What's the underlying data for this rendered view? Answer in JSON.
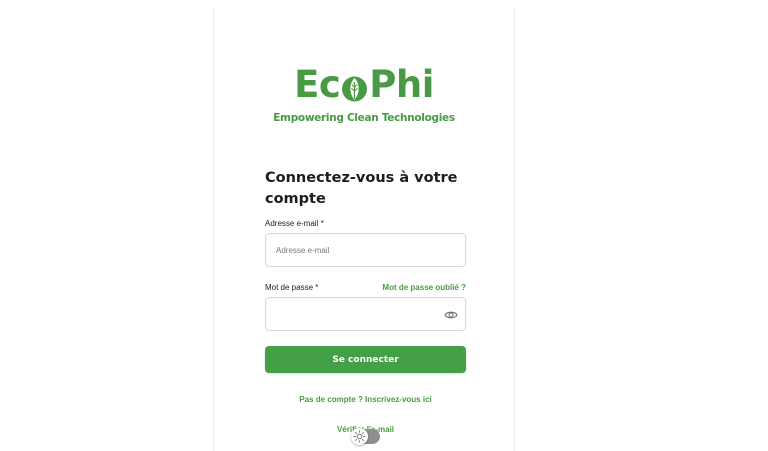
{
  "brand": {
    "name_left": "Ec",
    "name_right": "Phi",
    "tagline": "Empowering Clean Technologies"
  },
  "form": {
    "title": "Connectez-vous à votre compte",
    "email_label": "Adresse e-mail *",
    "email_placeholder": "Adresse e-mail",
    "email_value": "",
    "password_label": "Mot de passe *",
    "forgot_password": "Mot de passe oublié ?",
    "password_value": "",
    "submit_label": "Se connecter",
    "signup_link": "Pas de compte ? Inscrivez-vous ici",
    "verify_link": "Vérifier l'e-mail"
  },
  "icons": {
    "logo_leaf": "leaf-icon",
    "password_toggle": "eye-icon",
    "theme_toggle": "sun-icon"
  },
  "theme": {
    "dark_mode": false
  },
  "colors": {
    "brand_green": "#4a9a45",
    "button_green": "#43a047",
    "title_text": "#1d1d1d",
    "toggle_track": "#8f8f8f"
  }
}
